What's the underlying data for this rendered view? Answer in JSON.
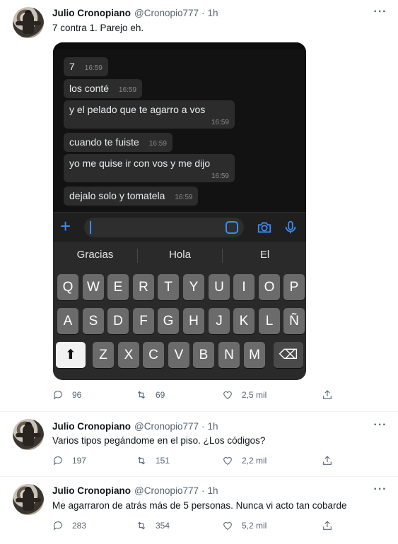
{
  "tweets": [
    {
      "name": "Julio Cronopiano",
      "handle": "@Cronopio777",
      "sep": "·",
      "time": "1h",
      "text": "7 contra 1. Parejo eh.",
      "replies": "96",
      "retweets": "69",
      "likes": "2,5 mil"
    },
    {
      "name": "Julio Cronopiano",
      "handle": "@Cronopio777",
      "sep": "·",
      "time": "1h",
      "text": "Varios tipos pegándome en el piso. ¿Los códigos?",
      "replies": "197",
      "retweets": "151",
      "likes": "2,2 mil"
    },
    {
      "name": "Julio Cronopiano",
      "handle": "@Cronopio777",
      "sep": "·",
      "time": "1h",
      "text": "Me agarraron de atrás más de 5 personas. Nunca vi acto tan cobarde",
      "replies": "283",
      "retweets": "354",
      "likes": "5,2 mil"
    }
  ],
  "more_glyph": "···",
  "media": {
    "messages": [
      {
        "text": "7",
        "time": "16:59"
      },
      {
        "text": "los conté",
        "time": "16:59"
      },
      {
        "text": "y el pelado que te agarro a vos",
        "time": "16:59"
      },
      {
        "text": "cuando te fuiste",
        "time": "16:59"
      },
      {
        "text": "yo me quise ir con vos y me dijo",
        "time": "16:59"
      },
      {
        "text": "dejalo solo y tomatela",
        "time": "16:59"
      }
    ],
    "plus": "+",
    "suggestions": [
      "Gracias",
      "Hola",
      "El"
    ],
    "row1": [
      "Q",
      "W",
      "E",
      "R",
      "T",
      "Y",
      "U",
      "I",
      "O",
      "P"
    ],
    "row2": [
      "A",
      "S",
      "D",
      "F",
      "G",
      "H",
      "J",
      "K",
      "L",
      "Ñ"
    ],
    "row3": [
      "Z",
      "X",
      "C",
      "V",
      "B",
      "N",
      "M"
    ],
    "shift": "⬆",
    "backspace": "⌫"
  },
  "colors": {
    "accent": "#3b8cf5",
    "secondary_text": "#536471"
  }
}
